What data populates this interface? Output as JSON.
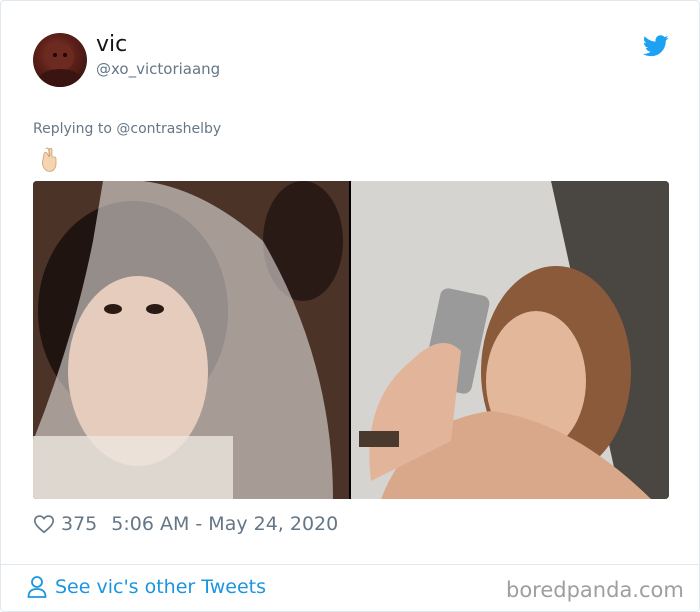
{
  "user": {
    "display_name": "vic",
    "handle": "@xo_victoriaang",
    "avatar_icon": "profile-photo"
  },
  "tweet": {
    "replying_to": "Replying to @contrashelby",
    "body_emoji": "crossed-fingers-emoji",
    "media": [
      {
        "description_icon": "vintage-bride-photo"
      },
      {
        "description_icon": "mirror-selfie-photo"
      }
    ],
    "likes": "375",
    "timestamp": "5:06 AM - May 24, 2020"
  },
  "footer": {
    "see_more_label": "See vic's other Tweets",
    "watermark": "boredpanda.com"
  },
  "colors": {
    "twitter_blue": "#1da1f2",
    "link_blue": "#1b95e0",
    "secondary_text": "#657786",
    "border": "#e1e8ed"
  }
}
